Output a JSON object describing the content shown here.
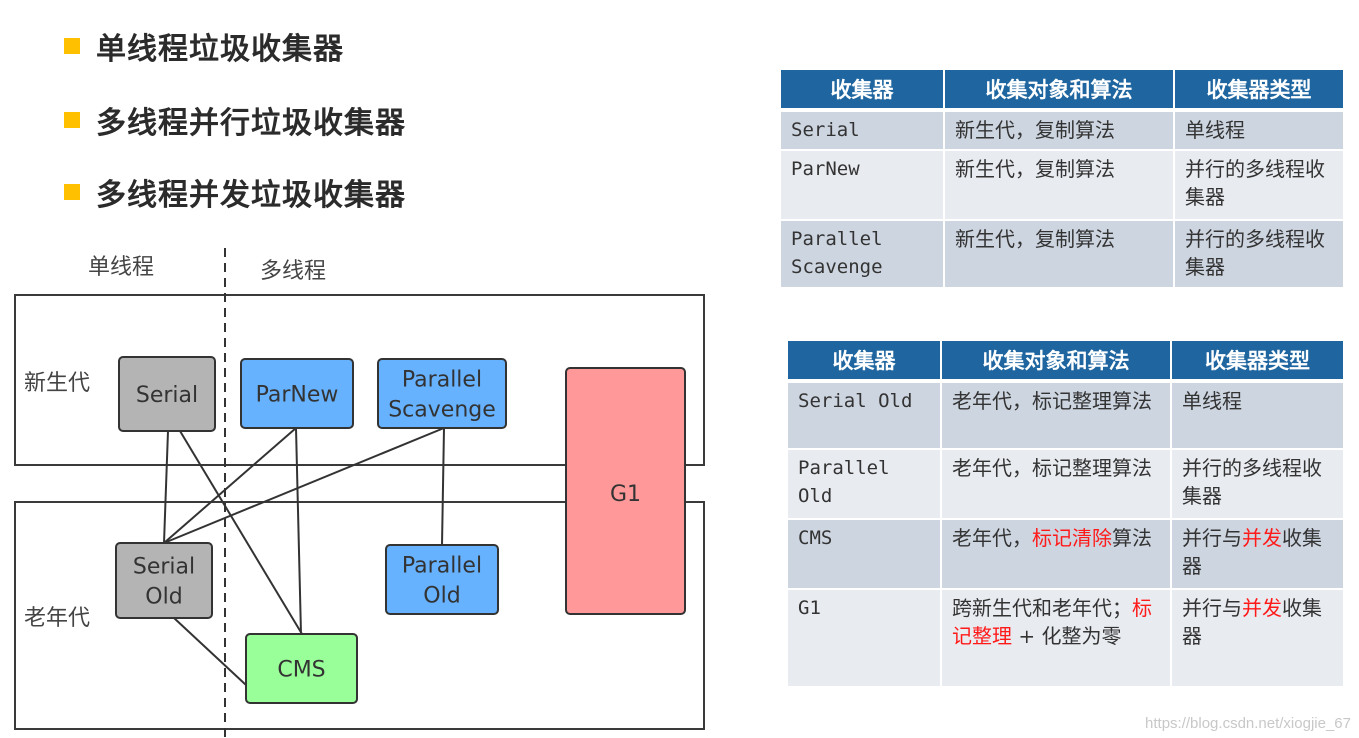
{
  "bullets": [
    {
      "text": "单线程垃圾收集器"
    },
    {
      "text": "多线程并行垃圾收集器"
    },
    {
      "text": "多线程并发垃圾收集器"
    }
  ],
  "diagram": {
    "column_labels": {
      "single": "单线程",
      "multi": "多线程"
    },
    "region_labels": {
      "young": "新生代",
      "old": "老年代"
    },
    "nodes": {
      "serial": {
        "label": [
          "Serial"
        ],
        "color": "#b4b4b4"
      },
      "parnew": {
        "label": [
          "ParNew"
        ],
        "color": "#66b2ff"
      },
      "parallel_scavenge": {
        "label": [
          "Parallel",
          "Scavenge"
        ],
        "color": "#66b2ff"
      },
      "g1": {
        "label": [
          "G1"
        ],
        "color": "#ff9999"
      },
      "serial_old": {
        "label": [
          "Serial",
          "Old"
        ],
        "color": "#b4b4b4"
      },
      "parallel_old": {
        "label": [
          "Parallel",
          "Old"
        ],
        "color": "#66b2ff"
      },
      "cms": {
        "label": [
          "CMS"
        ],
        "color": "#99ff99"
      }
    },
    "edges": [
      [
        "serial",
        "serial_old"
      ],
      [
        "serial",
        "cms"
      ],
      [
        "parnew",
        "serial_old"
      ],
      [
        "parnew",
        "cms"
      ],
      [
        "parallel_scavenge",
        "serial_old"
      ],
      [
        "parallel_scavenge",
        "parallel_old"
      ],
      [
        "serial_old",
        "cms"
      ]
    ]
  },
  "table_young": {
    "headers": [
      "收集器",
      "收集对象和算法",
      "收集器类型"
    ],
    "rows": [
      {
        "collector": "Serial",
        "target": [
          {
            "t": "新生代，复制算法"
          }
        ],
        "type": [
          {
            "t": "单线程"
          }
        ]
      },
      {
        "collector": "ParNew",
        "target": [
          {
            "t": "新生代，复制算法"
          }
        ],
        "type": [
          {
            "t": "并行的多线程收集器"
          }
        ]
      },
      {
        "collector": "Parallel Scavenge",
        "target": [
          {
            "t": "新生代，复制算法"
          }
        ],
        "type": [
          {
            "t": "并行的多线程收集器"
          }
        ]
      }
    ]
  },
  "table_old": {
    "headers": [
      "收集器",
      "收集对象和算法",
      "收集器类型"
    ],
    "rows": [
      {
        "collector": "Serial Old",
        "target": [
          {
            "t": "老年代，标记整理算法"
          }
        ],
        "type": [
          {
            "t": "单线程"
          }
        ]
      },
      {
        "collector": "Parallel Old",
        "target": [
          {
            "t": "老年代，标记整理算法"
          }
        ],
        "type": [
          {
            "t": "并行的多线程收集器"
          }
        ]
      },
      {
        "collector": "CMS",
        "target": [
          {
            "t": "老年代，"
          },
          {
            "t": "标记清除",
            "hl": true
          },
          {
            "t": "算法"
          }
        ],
        "type": [
          {
            "t": "并行与"
          },
          {
            "t": "并发",
            "hl": true
          },
          {
            "t": "收集器"
          }
        ]
      },
      {
        "collector": "G1",
        "target": [
          {
            "t": "跨新生代和老年代；"
          },
          {
            "t": "标记整理",
            "hl": true
          },
          {
            "t": " + 化整为零"
          }
        ],
        "type": [
          {
            "t": "并行与"
          },
          {
            "t": "并发",
            "hl": true
          },
          {
            "t": "收集器"
          }
        ]
      }
    ]
  },
  "highlight_color": "#ff1a1a",
  "watermark": "https://blog.csdn.net/xiogjie_67"
}
